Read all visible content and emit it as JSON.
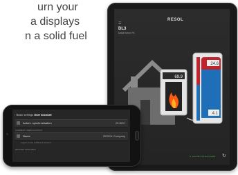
{
  "promo": {
    "line1": "urn your",
    "line2": "a displays",
    "line3": "n a solid fuel"
  },
  "tablet": {
    "status_bar": "....",
    "brand": "RESOL",
    "menu_icon": "menu-icon",
    "device_title": "DL3",
    "device_subtitle": "DeltaTherm FK",
    "boiler_temp": "69.9",
    "tank_top_temp": "24.6",
    "tank_bottom_temp": "4.1",
    "footer_text": "6. Juni 2017 09:16:24 CEST",
    "refresh_icon": "refresh-icon",
    "colors": {
      "flame": "#ff5a14",
      "tank_hot": "#c0232b",
      "tank_cold": "#1e6fb8",
      "footer": "#4db04d"
    }
  },
  "phone": {
    "status_bar": "....",
    "back_label": "Basic settings",
    "screen_title": "User account",
    "rows": [
      {
        "label": "Autom. synchronisation",
        "value": "20 DEC"
      },
      {
        "label": "Name",
        "value": "RESOL Company"
      }
    ],
    "section_current": "CURRENT USER ACCOUNT",
    "logout_note": "Logout to use a different account.",
    "section_devices": "DEVICES AVAILABLE"
  }
}
